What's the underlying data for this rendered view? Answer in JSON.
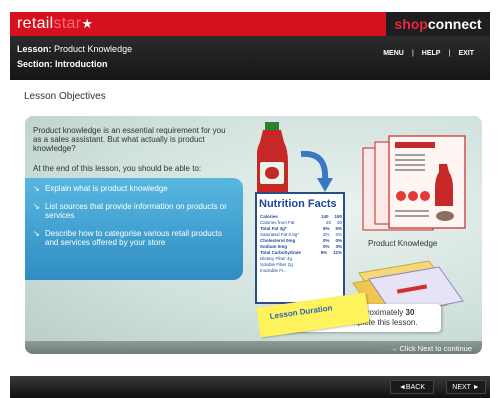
{
  "brand": {
    "left_part1": "retail",
    "left_part2": "star",
    "left_star": "★",
    "right_part1": "shop",
    "right_part2": "connect"
  },
  "lesson": {
    "lesson_label": "Lesson:",
    "lesson_value": "Product Knowledge",
    "section_label": "Section:",
    "section_value": "Introduction"
  },
  "topnav": {
    "menu": "MENU",
    "help": "HELP",
    "exit": "EXIT",
    "sep": "|"
  },
  "page": {
    "title": "Lesson Objectives"
  },
  "content": {
    "intro": "Product knowledge is an essential requirement for you as a sales assistant. But what actually is product knowledge?",
    "sub": "At the end of this lesson, you should be able to:",
    "bullet_glyph": "↘",
    "objectives": [
      "Explain what is product knowledge",
      "List sources that provide information on products or services",
      "Describe how to categorise various retail products and services offered by your store"
    ],
    "illustration_caption": "Product Knowledge",
    "nutrition": {
      "title": "Nutrition Facts",
      "rows": [
        {
          "label": "Calories",
          "a": "140",
          "b": "190",
          "bold": true
        },
        {
          "label": "Calories from Fat",
          "a": "25",
          "b": "30",
          "bold": false
        },
        {
          "label": "Total Fat 3g*",
          "a": "5%",
          "b": "5%",
          "bold": true
        },
        {
          "label": "Saturated Fat 0.5g*",
          "a": "3%",
          "b": "3%",
          "bold": false
        },
        {
          "label": "Cholesterol 0mg",
          "a": "0%",
          "b": "0%",
          "bold": true
        },
        {
          "label": "Sodium 0mg",
          "a": "0%",
          "b": "3%",
          "bold": true
        },
        {
          "label": "Total Carbohydrate",
          "a": "9%",
          "b": "11%",
          "bold": true
        },
        {
          "label": "Dietary Fiber 4g",
          "a": "",
          "b": "",
          "bold": false
        },
        {
          "label": "Soluble Fiber 2g",
          "a": "",
          "b": "",
          "bold": false
        },
        {
          "label": "Insoluble Fi...",
          "a": "",
          "b": "",
          "bold": false
        }
      ]
    },
    "duration_label": "Lesson Duration",
    "duration_text_pre": "It will take you approximately ",
    "duration_text_bold": "30 minutes",
    "duration_text_post": " to complete this lesson.",
    "next_hint": "→ Click Next to continue"
  },
  "footer": {
    "back": "◄BACK",
    "next": "NEXT ►"
  },
  "colors": {
    "brand_red": "#d5101f",
    "objective_blue": "#3a9bd0",
    "note_yellow": "#fff35c"
  }
}
